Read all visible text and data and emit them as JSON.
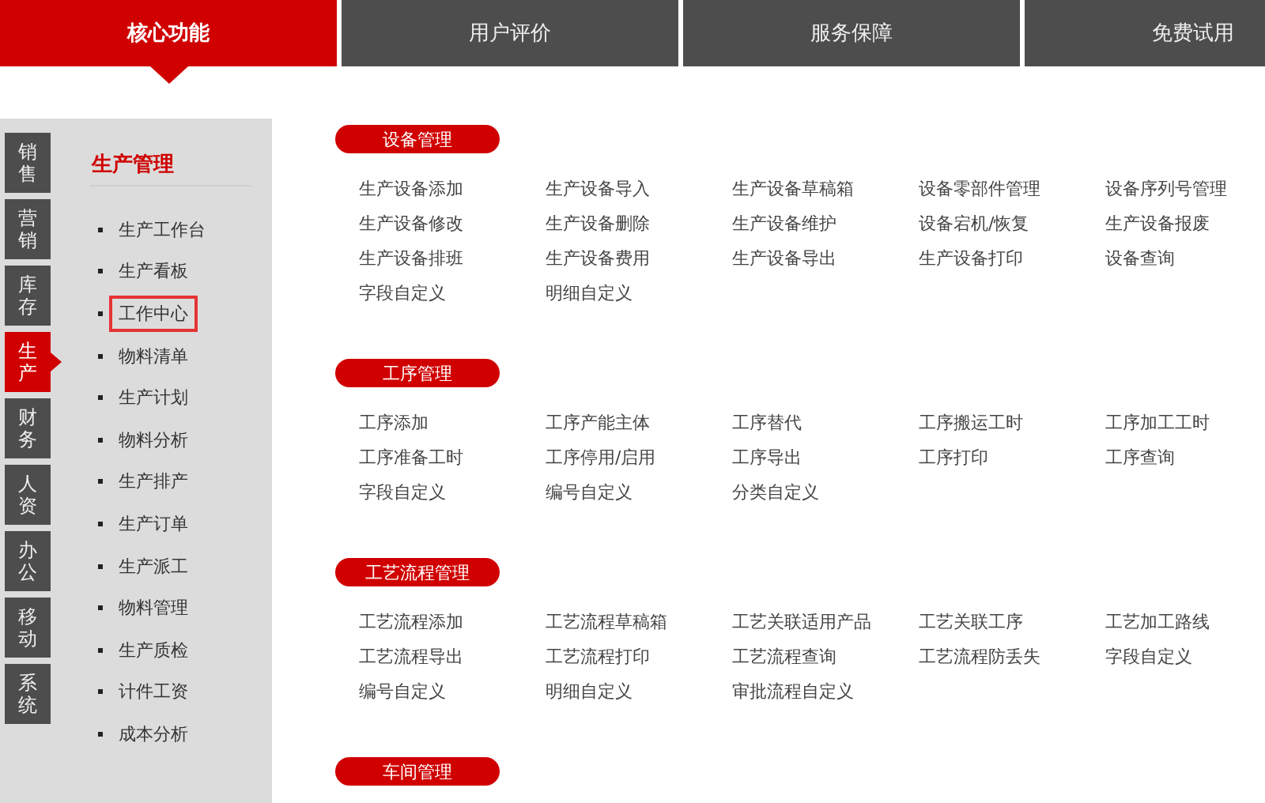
{
  "tabs": [
    {
      "label": "核心功能",
      "selected": true
    },
    {
      "label": "用户评价",
      "selected": false
    },
    {
      "label": "服务保障",
      "selected": false
    },
    {
      "label": "免费试用",
      "selected": false
    }
  ],
  "categories": [
    {
      "label": "销售",
      "selected": false
    },
    {
      "label": "营销",
      "selected": false
    },
    {
      "label": "库存",
      "selected": false
    },
    {
      "label": "生产",
      "selected": true
    },
    {
      "label": "财务",
      "selected": false
    },
    {
      "label": "人资",
      "selected": false
    },
    {
      "label": "办公",
      "selected": false
    },
    {
      "label": "移动",
      "selected": false
    },
    {
      "label": "系统",
      "selected": false
    }
  ],
  "submenu": {
    "title": "生产管理",
    "items": [
      {
        "label": "生产工作台",
        "selected": false
      },
      {
        "label": "生产看板",
        "selected": false
      },
      {
        "label": "工作中心",
        "selected": true
      },
      {
        "label": "物料清单",
        "selected": false
      },
      {
        "label": "生产计划",
        "selected": false
      },
      {
        "label": "物料分析",
        "selected": false
      },
      {
        "label": "生产排产",
        "selected": false
      },
      {
        "label": "生产订单",
        "selected": false
      },
      {
        "label": "生产派工",
        "selected": false
      },
      {
        "label": "物料管理",
        "selected": false
      },
      {
        "label": "生产质检",
        "selected": false
      },
      {
        "label": "计件工资",
        "selected": false
      },
      {
        "label": "成本分析",
        "selected": false
      }
    ]
  },
  "sections": [
    {
      "title": "设备管理",
      "items": [
        "生产设备添加",
        "生产设备导入",
        "生产设备草稿箱",
        "设备零部件管理",
        "设备序列号管理",
        "生产设备修改",
        "生产设备删除",
        "生产设备维护",
        "设备宕机/恢复",
        "生产设备报废",
        "生产设备排班",
        "生产设备费用",
        "生产设备导出",
        "生产设备打印",
        "设备查询",
        "字段自定义",
        "明细自定义"
      ]
    },
    {
      "title": "工序管理",
      "items": [
        "工序添加",
        "工序产能主体",
        "工序替代",
        "工序搬运工时",
        "工序加工工时",
        "工序准备工时",
        "工序停用/启用",
        "工序导出",
        "工序打印",
        "工序查询",
        "字段自定义",
        "编号自定义",
        "分类自定义"
      ]
    },
    {
      "title": "工艺流程管理",
      "items": [
        "工艺流程添加",
        "工艺流程草稿箱",
        "工艺关联适用产品",
        "工艺关联工序",
        "工艺加工路线",
        "工艺流程导出",
        "工艺流程打印",
        "工艺流程查询",
        "工艺流程防丢失",
        "字段自定义",
        "编号自定义",
        "明细自定义",
        "审批流程自定义"
      ]
    },
    {
      "title": "车间管理"
    }
  ]
}
